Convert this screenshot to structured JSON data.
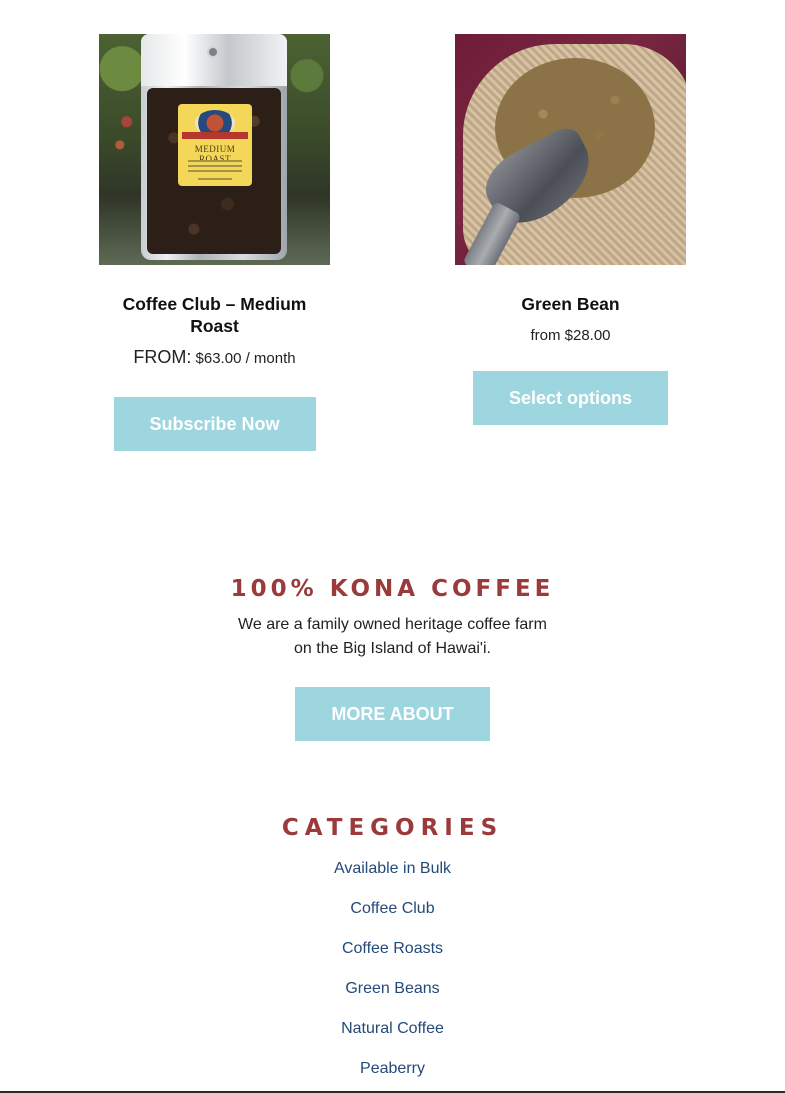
{
  "products": [
    {
      "title": "Coffee Club – Medium Roast",
      "price_prefix": "FROM:",
      "price": "$63.00",
      "price_suffix": "/ month",
      "button_label": "Subscribe Now",
      "bag_label": "MEDIUM ROAST"
    },
    {
      "title": "Green Bean",
      "price_text": "from $28.00",
      "button_label": "Select options"
    }
  ],
  "about": {
    "heading": "100% KONA COFFEE",
    "text": "We are a family owned heritage coffee farm on the Big Island of Hawai'i.",
    "button_label": "MORE ABOUT"
  },
  "categories": {
    "heading": "CATEGORIES",
    "items": [
      "Available in Bulk",
      "Coffee Club",
      "Coffee Roasts",
      "Green Beans",
      "Natural Coffee",
      "Peaberry"
    ]
  },
  "colors": {
    "button_bg": "#9ed6e0",
    "heading_red": "#9b3a3a",
    "link_blue": "#234a78"
  }
}
